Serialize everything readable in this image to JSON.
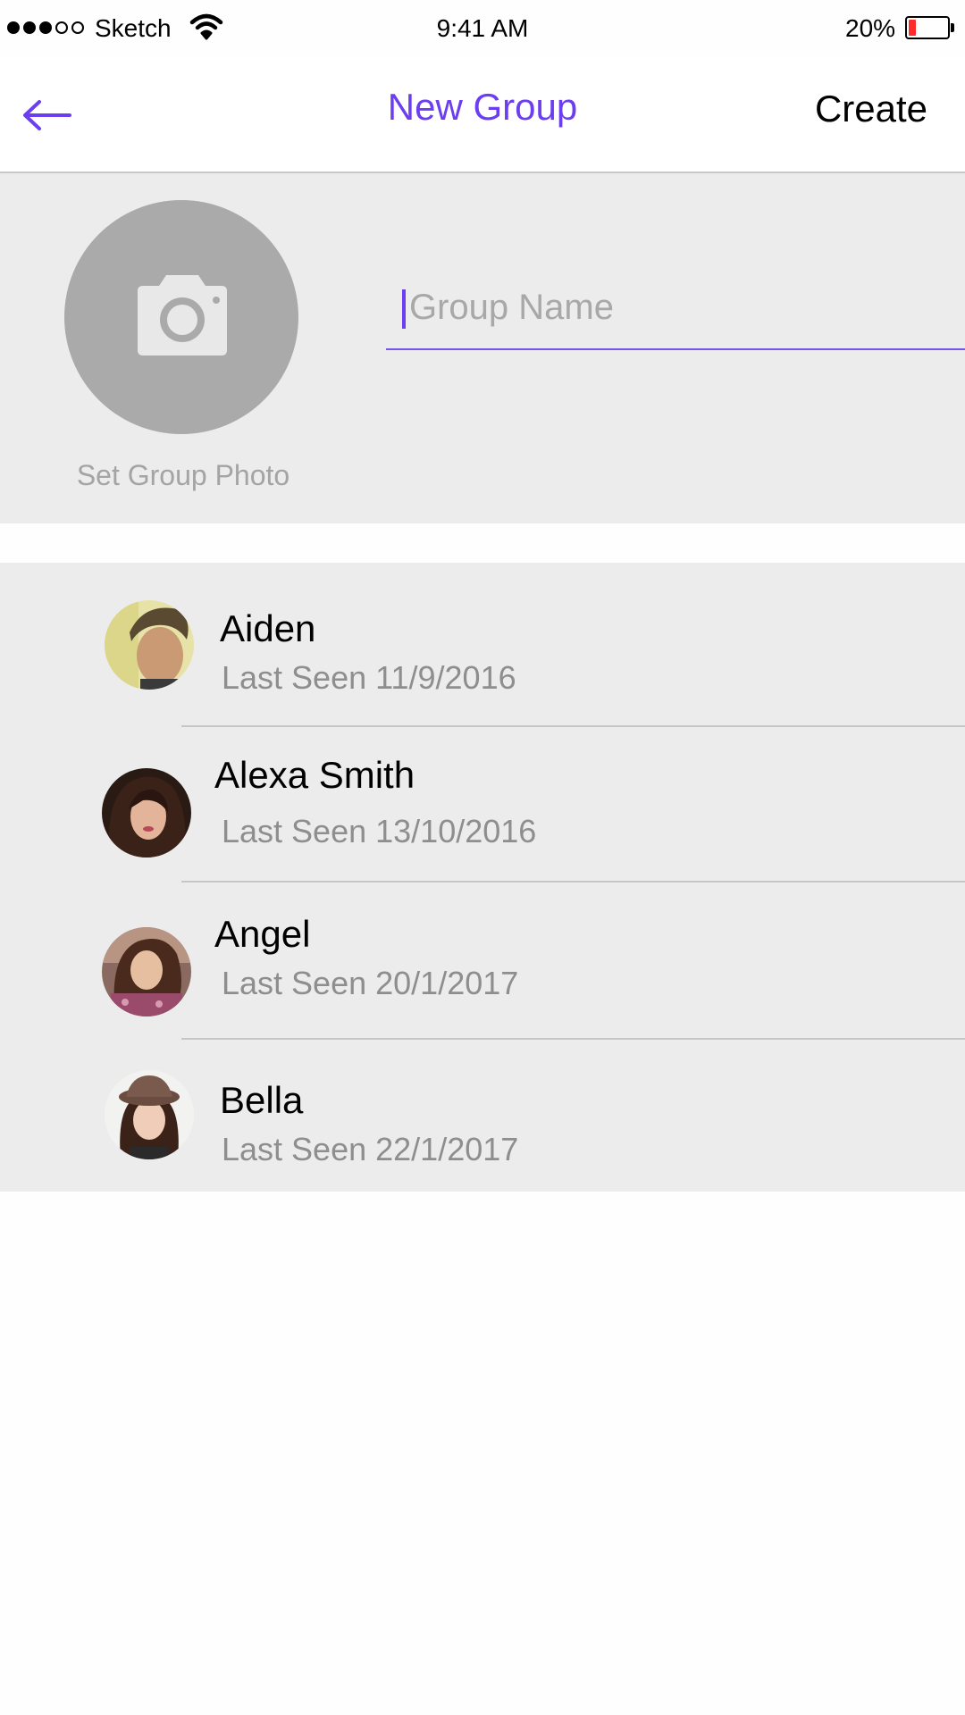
{
  "status_bar": {
    "carrier": "Sketch",
    "time": "9:41 AM",
    "battery_percent": "20%",
    "battery_level": 0.2,
    "signal_bars_filled": 3,
    "signal_bars_total": 5,
    "battery_color": "#ff2b2b"
  },
  "nav": {
    "back_icon": "back-arrow-icon",
    "title": "New Group",
    "action_label": "Create",
    "accent_color": "#6b3ff0"
  },
  "group": {
    "photo_icon": "camera-icon",
    "photo_label": "Set Group Photo",
    "name_placeholder": "Group Name",
    "name_value": ""
  },
  "contacts": [
    {
      "name": "Aiden",
      "last_seen": "Last Seen 11/9/2016"
    },
    {
      "name": "Alexa Smith",
      "last_seen": "Last Seen 13/10/2016"
    },
    {
      "name": "Angel",
      "last_seen": "Last Seen 20/1/2017"
    },
    {
      "name": "Bella",
      "last_seen": "Last Seen 22/1/2017"
    }
  ]
}
